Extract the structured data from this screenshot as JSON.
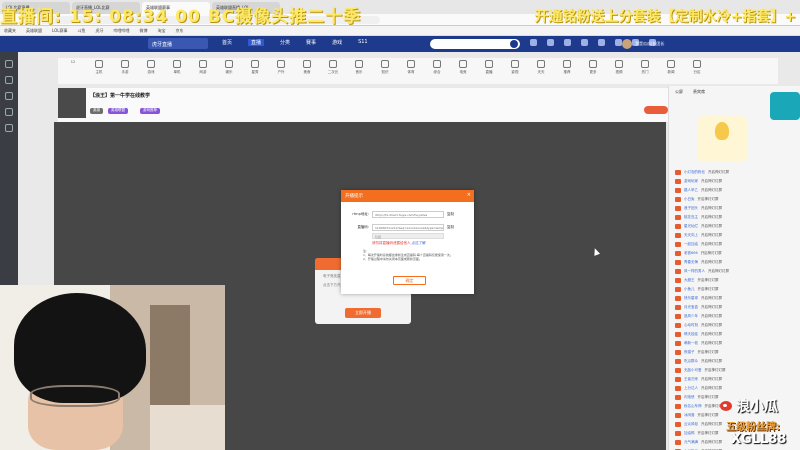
{
  "browser": {
    "tabs": [
      "LOL比赛直播",
      "虎牙直播_LOL比赛",
      "英雄联盟赛事",
      "英雄联盟直播_LOL"
    ],
    "bookmarks": [
      "收藏夹",
      "英雄联盟",
      "LOL赛事",
      "斗鱼",
      "虎牙",
      "哔哩哔哩",
      "微博",
      "淘宝",
      "京东"
    ]
  },
  "overlay": {
    "left_text": "直播间: 15: 08:34 00 BC摄像头推二十季",
    "right_text": "开通铭粉送上分套装【定制水冷+指套】+"
  },
  "site": {
    "logo": "虎牙直播",
    "nav": [
      "首页",
      "直播",
      "分类",
      "赛事",
      "游戏",
      "S11"
    ],
    "active_nav": 1,
    "user_name": "我是瓜瓜/长团长"
  },
  "category": {
    "count": "12",
    "items": [
      "主机",
      "手游",
      "游戏",
      "单机",
      "网游",
      "娱乐",
      "星秀",
      "户外",
      "美食",
      "二次元",
      "音乐",
      "知识",
      "体育",
      "综合",
      "电竞",
      "直播",
      "影视",
      "天天",
      "推荐",
      "更多",
      "视频",
      "热门",
      "新闻",
      "分区"
    ]
  },
  "room": {
    "title": "【浪王】第一牛学在线教学",
    "tags": [
      "英雄",
      "英雄联盟",
      "游戏推荐"
    ]
  },
  "chat": {
    "tabs": [
      "公屏",
      "贵宾席"
    ],
    "lines": [
      {
        "name": "小灯泡的粉丝",
        "text": "开启神灯灯屏"
      },
      {
        "name": "游戏玩家",
        "text": "开启神灯灯屏"
      },
      {
        "name": "路人甲乙",
        "text": "开启神灯灯屏"
      },
      {
        "name": "小白兔",
        "text": "开启神灯灯屏"
      },
      {
        "name": "浪子回头",
        "text": "开启神灯灯屏"
      },
      {
        "name": "桃花岛主",
        "text": "开启神灯灯屏"
      },
      {
        "name": "星光灿烂",
        "text": "开启神灯灯屏"
      },
      {
        "name": "天天向上",
        "text": "开启神灯灯屏"
      },
      {
        "name": "一起加油",
        "text": "开启神灯灯屏"
      },
      {
        "name": "老铁666",
        "text": "开启神灯灯屏"
      },
      {
        "name": "青春无悔",
        "text": "开启神灯灯屏"
      },
      {
        "name": "风一样的男人",
        "text": "开启神灯灯屏"
      },
      {
        "name": "大魔王",
        "text": "开启神灯灯屏"
      },
      {
        "name": "小鱼儿",
        "text": "开启神灯灯屏"
      },
      {
        "name": "快乐星球",
        "text": "开启神灯灯屏"
      },
      {
        "name": "月光宝盒",
        "text": "开启神灯灯屏"
      },
      {
        "name": "追风少年",
        "text": "开启神灯灯屏"
      },
      {
        "name": "心动时刻",
        "text": "开启神灯灯屏"
      },
      {
        "name": "晴天娃娃",
        "text": "开启神灯灯屏"
      },
      {
        "name": "萌新一枚",
        "text": "开启神灯灯屏"
      },
      {
        "name": "夜猫子",
        "text": "开启神灯灯屏"
      },
      {
        "name": "吃瓜群众",
        "text": "开启神灯灯屏"
      },
      {
        "name": "无敌小可爱",
        "text": "开启神灯灯屏"
      },
      {
        "name": "王者归来",
        "text": "开启神灯灯屏"
      },
      {
        "name": "上分达人",
        "text": "开启神灯灯屏"
      },
      {
        "name": "闪电侠",
        "text": "开启神灯灯屏"
      },
      {
        "name": "秋名山车神",
        "text": "开启神灯灯屏"
      },
      {
        "name": "冰阔落",
        "text": "开启神灯灯屏"
      },
      {
        "name": "云淡风轻",
        "text": "开启神灯灯屏"
      },
      {
        "name": "加油鸭",
        "text": "开启神灯灯屏"
      },
      {
        "name": "元气满满",
        "text": "开启神灯灯屏"
      },
      {
        "name": "小瓜粉丝",
        "text": "开启神灯灯屏"
      }
    ]
  },
  "back_dialog": {
    "line1": "电子竞技直播间",
    "line2": "点击下方开启直播",
    "button": "立即开播"
  },
  "modal": {
    "title": "开播提示",
    "close": "×",
    "rtmp_label": "rtmp地址:",
    "rtmp_value": "rtmp://tx.direct.huya.com/huyalive",
    "rtmp_action": "复制",
    "key_label": "直播码:",
    "key_value": "1199307xxxxx?seq=xxxxxxxxxx&type=simple",
    "key_action": "复制",
    "code_hint": "隐藏",
    "warn": "请勿将直播码泄露给他人,",
    "warn_link": "点这了解",
    "notes": [
      "注:",
      "1、每次开播时系统都会重新生成直播码,每个直播码仅能使用一次。",
      "2、开播过程中请勿关闭本页面或刷新页面。"
    ],
    "ok": "确定"
  },
  "watermark": {
    "weibo_name": "浪小瓜",
    "fan_label": "五级粉丝牌:",
    "fan_code": "XGLL88"
  },
  "colors": {
    "accent": "#f36f1f",
    "header": "#1d3a8c",
    "overlay_text": "#ffe95a"
  }
}
